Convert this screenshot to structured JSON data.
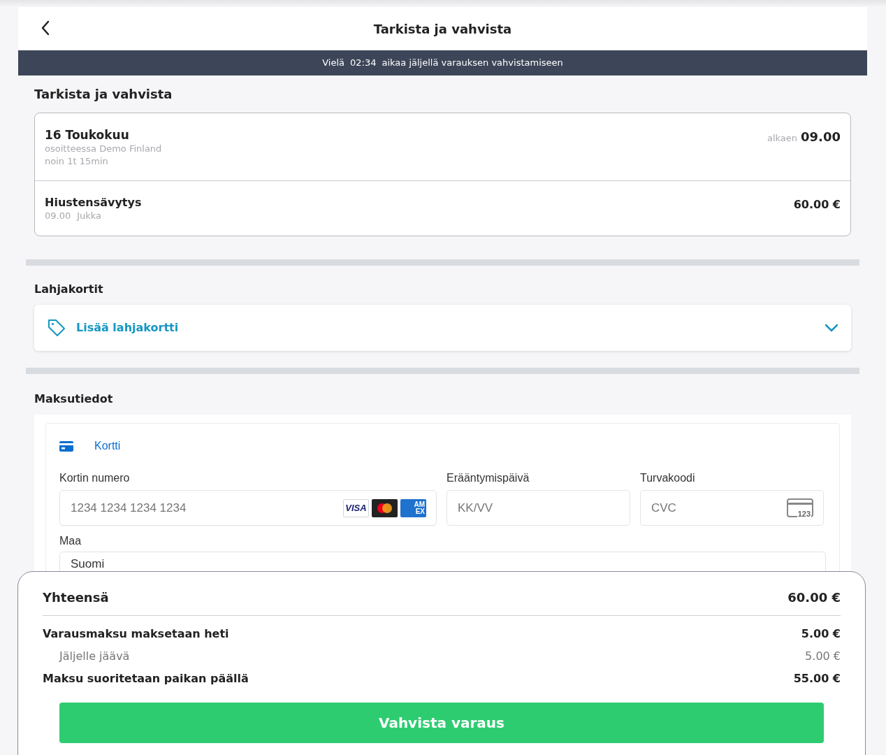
{
  "header": {
    "title": "Tarkista ja vahvista"
  },
  "timer_banner": {
    "prefix": "Vielä",
    "time": "02:34",
    "suffix": "aikaa jäljellä varauksen vahvistamiseen"
  },
  "review": {
    "heading": "Tarkista ja vahvista",
    "date": "16 Toukokuu",
    "location": "osoitteessa Demo Finland",
    "duration": "noin 1t 15min",
    "start_label": "alkaen",
    "start_time": "09.00",
    "services": [
      {
        "name": "Hiustensävytys",
        "time": "09.00",
        "staff": "Jukka",
        "price": "60.00 €"
      }
    ]
  },
  "gift_cards": {
    "heading": "Lahjakortit",
    "add_label": "Lisää lahjakortti",
    "expanded": false
  },
  "payment": {
    "heading": "Maksutiedot",
    "methods": [
      {
        "label": "Kortti",
        "selected": true
      }
    ],
    "card_number": {
      "label": "Kortin numero",
      "placeholder": "1234 1234 1234 1234"
    },
    "card_brands": [
      {
        "kind": "visa",
        "text": "VISA"
      },
      {
        "kind": "mastercard"
      },
      {
        "kind": "amex",
        "text": "AM",
        "text2": "EX"
      }
    ],
    "expiry": {
      "label": "Erääntymispäivä",
      "placeholder": "KK/VV"
    },
    "cvc": {
      "label": "Turvakoodi",
      "placeholder": "CVC",
      "icon_text": "123"
    },
    "country": {
      "label": "Maa",
      "value": "Suomi"
    }
  },
  "summary": {
    "total_label": "Yhteensä",
    "total": "60.00 €",
    "rows": [
      {
        "kind": "main",
        "label": "Varausmaksu maksetaan heti",
        "value": "5.00 €"
      },
      {
        "kind": "sub",
        "label": "Jäljelle jäävä",
        "value": "5.00 €"
      },
      {
        "kind": "main",
        "label": "Maksu suoritetaan paikan päällä",
        "value": "55.00 €"
      }
    ],
    "confirm_button": "Vahvista varaus"
  }
}
